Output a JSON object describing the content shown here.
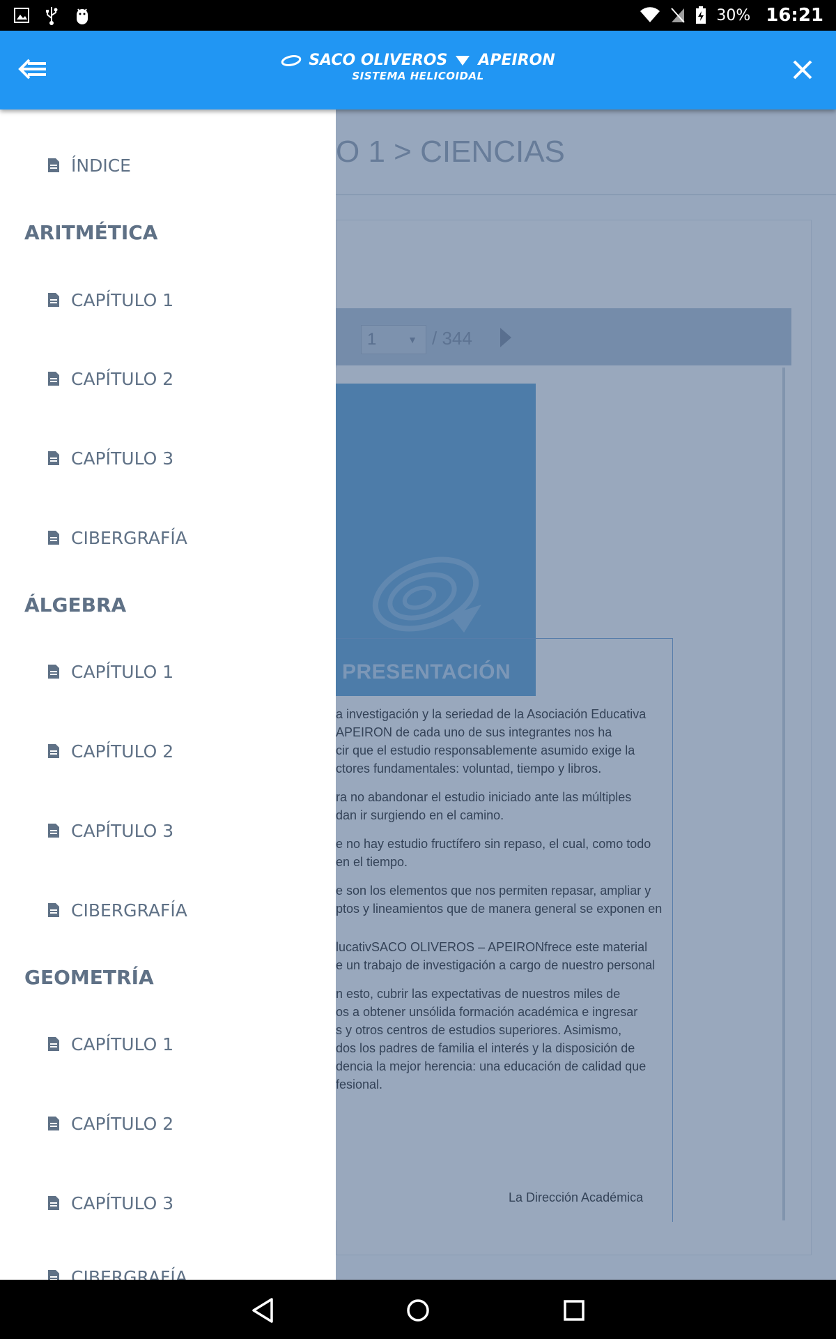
{
  "status_bar": {
    "icons_left": [
      "image-icon",
      "usb-icon",
      "android-debug-icon"
    ],
    "icons_right": [
      "wifi-icon",
      "no-sim-icon",
      "battery-charging-icon"
    ],
    "battery": "30%",
    "time": "16:21"
  },
  "app_bar": {
    "logo_line1_left": "SACO OLIVEROS",
    "logo_line1_right": "APEIRON",
    "logo_line2": "SISTEMA HELICOIDAL",
    "brand_color": "#2196f3"
  },
  "drawer": {
    "index_item": "ÍNDICE",
    "sections": [
      {
        "title": "ARITMÉTICA",
        "items": [
          "CAPÍTULO 1",
          "CAPÍTULO 2",
          "CAPÍTULO 3",
          "CIBERGRAFÍA"
        ]
      },
      {
        "title": "ÁLGEBRA",
        "items": [
          "CAPÍTULO 1",
          "CAPÍTULO 2",
          "CAPÍTULO 3",
          "CIBERGRAFÍA"
        ]
      },
      {
        "title": "GEOMETRÍA",
        "items": [
          "CAPÍTULO 1",
          "CAPÍTULO 2",
          "CAPÍTULO 3",
          "CIBERGRAFÍA"
        ]
      }
    ]
  },
  "background_page": {
    "breadcrumb": "O 1 > CIENCIAS",
    "current_page": "1",
    "total_pages": "/ 344",
    "presentation_title": "PRESENTACIÓN",
    "text_lines": [
      "a investigación y la seriedad de la Asociación Educativa",
      "  APEIRON de cada uno de sus integrantes nos ha",
      "cir que el estudio responsablemente asumido exige la",
      "ctores fundamentales: voluntad, tiempo y libros.",
      "ra no abandonar el estudio iniciado ante las múltiples",
      "dan ir surgiendo en el camino.",
      "e no hay estudio fructífero sin repaso, el cual, como todo",
      "en el tiempo.",
      "e son los elementos que nos permiten repasar, ampliar y",
      "ptos y lineamientos que de manera general se exponen en",
      "lucativSACO OLIVEROS – APEIRONfrece este material",
      "e un trabajo de investigación a cargo de nuestro personal",
      "n esto, cubrir las expectativas de nuestros miles de",
      "os a obtener unsólida formación académica e ingresar",
      "s y otros centros de estudios superiores. Asimismo,",
      "dos los padres de familia el interés y la disposición de",
      "dencia la mejor herencia: una educación de calidad que",
      "fesional."
    ],
    "signature": "La Dirección Académica"
  },
  "nav_bar": {
    "buttons": [
      "back-nav-icon",
      "home-nav-icon",
      "recents-nav-icon"
    ]
  }
}
